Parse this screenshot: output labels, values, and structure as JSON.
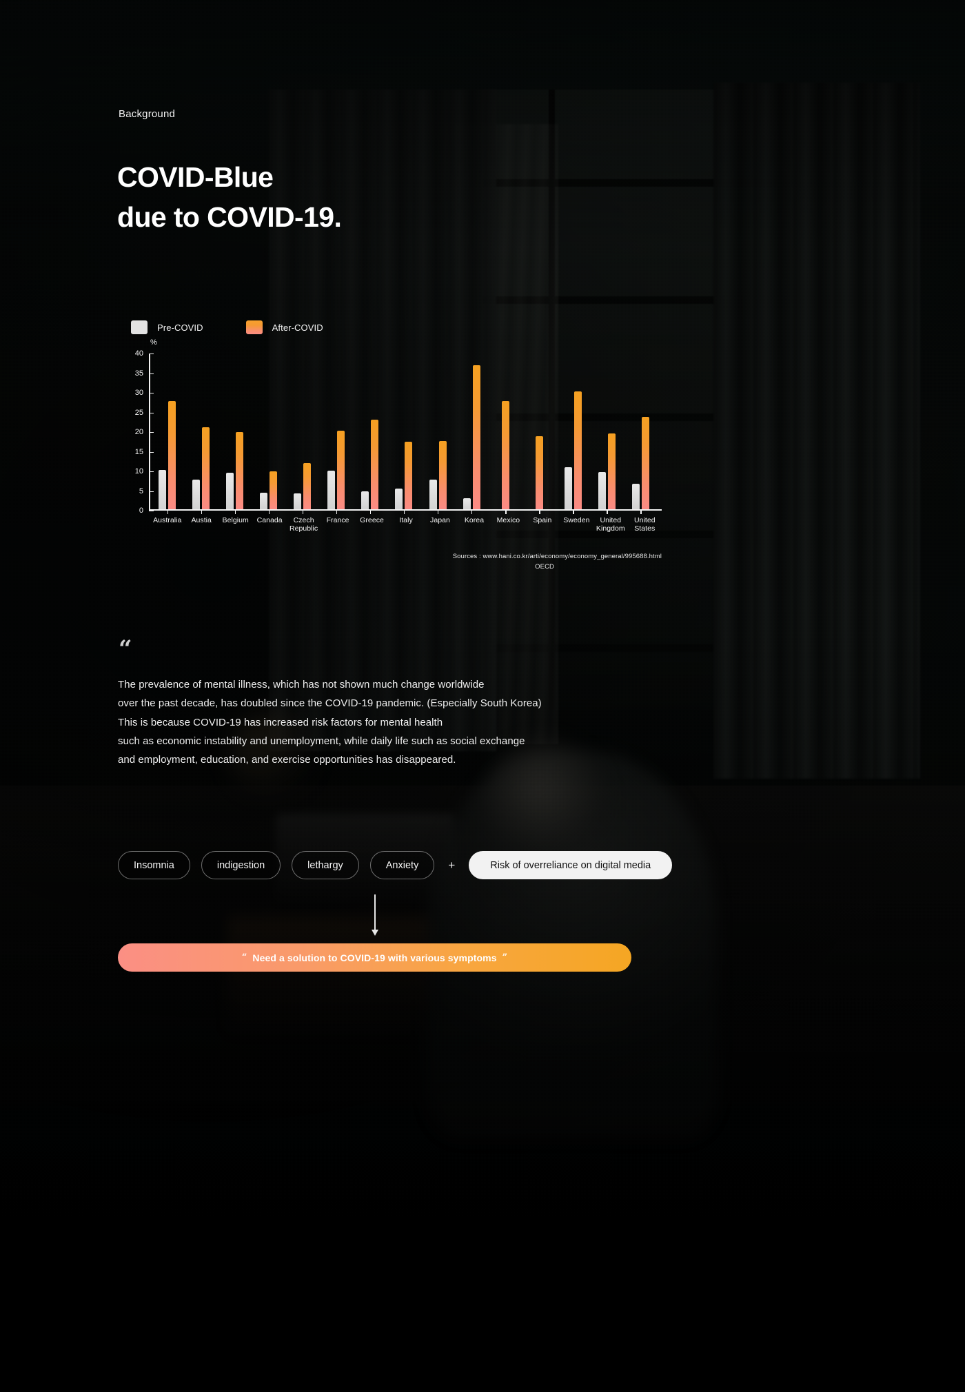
{
  "page": {
    "eyebrow": "Background",
    "headline_line1": "COVID-Blue",
    "headline_line2": "due to COVID-19."
  },
  "chart_data": {
    "type": "bar",
    "title": "",
    "xlabel": "",
    "ylabel": "%",
    "ylim": [
      0,
      40
    ],
    "yticks": [
      0,
      5,
      10,
      15,
      20,
      25,
      30,
      35,
      40
    ],
    "grid": false,
    "legend_position": "top-left",
    "categories": [
      "Australia",
      "Austia",
      "Belgium",
      "Canada",
      "Czech\nRepublic",
      "France",
      "Greece",
      "Italy",
      "Japan",
      "Korea",
      "Mexico",
      "Spain",
      "Sweden",
      "United\nKingdom",
      "United\nStates"
    ],
    "series": [
      {
        "name": "Pre-COVID",
        "color": "#e2e2e2",
        "values": [
          10.1,
          7.6,
          9.4,
          4.2,
          4.1,
          9.9,
          4.7,
          5.4,
          7.7,
          2.8,
          0.0,
          0.0,
          10.7,
          9.6,
          6.5
        ]
      },
      {
        "name": "After-COVID",
        "color": "#f5a021",
        "values": [
          27.6,
          21.0,
          19.8,
          9.8,
          11.8,
          20.1,
          22.9,
          17.3,
          17.4,
          36.8,
          27.6,
          18.6,
          30.0,
          19.3,
          23.5
        ]
      }
    ],
    "sources_line1": "Sources : www.hani.co.kr/arti/economy/economy_general/995688.html",
    "sources_line2": "OECD"
  },
  "legend": {
    "pre_label": "Pre-COVID",
    "post_label": "After-COVID"
  },
  "quote": {
    "mark": "“",
    "lines": [
      "The prevalence of mental illness, which has not shown much change worldwide",
      "over the past decade, has doubled since the COVID-19 pandemic. (Especially South Korea)",
      "This is because COVID-19 has increased risk factors for mental health",
      "such as economic instability and unemployment, while daily life such as social exchange",
      "and employment, education, and exercise opportunities has disappeared."
    ]
  },
  "symptoms": {
    "pills": [
      "Insomnia",
      "indigestion",
      "lethargy",
      "Anxiety"
    ],
    "plus": "+",
    "highlight": "Risk of overreliance on digital media"
  },
  "cta": {
    "quote_open": "“",
    "text": "Need a solution to COVID-19 with various symptoms",
    "quote_close": "”",
    "gradient_from": "#fb8f84",
    "gradient_to": "#f5a623"
  }
}
